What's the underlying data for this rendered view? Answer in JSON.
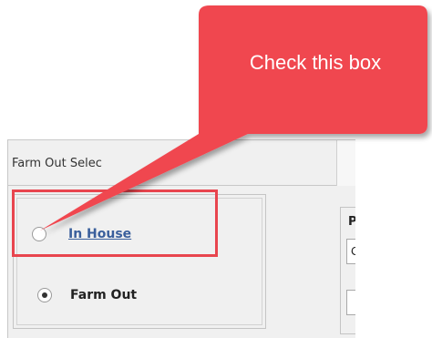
{
  "panel": {
    "title": "Farm Out Selec",
    "side_label": "P",
    "side_value": "C"
  },
  "options": [
    {
      "label": "In House",
      "selected": false
    },
    {
      "label": "Farm Out",
      "selected": true
    }
  ],
  "annotation": {
    "callout_text": "Check this box",
    "color": "#f04650",
    "highlight_color": "#e8454e"
  },
  "colors": {
    "link": "#3a5f9c",
    "panel_bg": "#f0f0f0"
  }
}
